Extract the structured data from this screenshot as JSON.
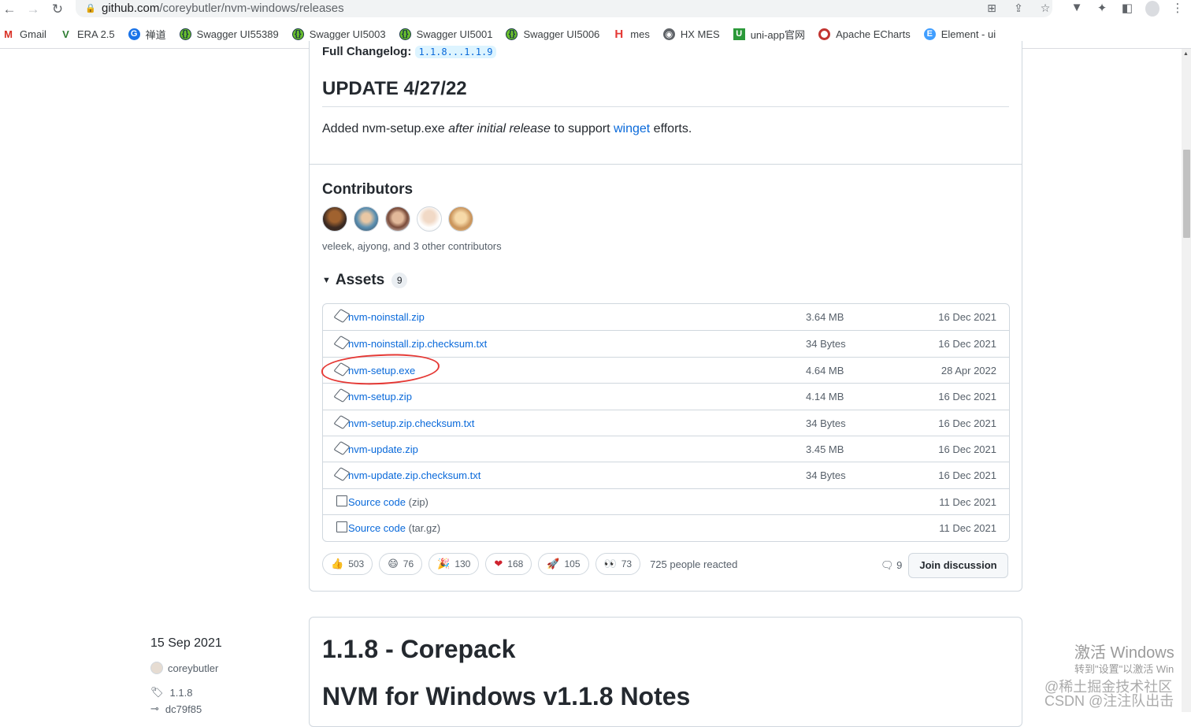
{
  "browser": {
    "url_host": "github.com",
    "url_path": "/coreybutler/nvm-windows/releases",
    "bookmarks": [
      {
        "label": "Gmail",
        "icon": "gmail-icon",
        "glyph": "M"
      },
      {
        "label": "ERA 2.5",
        "icon": "era-icon",
        "glyph": "V"
      },
      {
        "label": "禅道",
        "icon": "chandao-icon",
        "glyph": "G"
      },
      {
        "label": "Swagger UI55389",
        "icon": "swagger-icon",
        "glyph": "{}"
      },
      {
        "label": "Swagger UI5003",
        "icon": "swagger-icon",
        "glyph": "{}"
      },
      {
        "label": "Swagger UI5001",
        "icon": "swagger-icon",
        "glyph": "{}"
      },
      {
        "label": "Swagger UI5006",
        "icon": "swagger-icon",
        "glyph": "{}"
      },
      {
        "label": "mes",
        "icon": "mes-icon",
        "glyph": "H"
      },
      {
        "label": "HX MES",
        "icon": "globe-icon",
        "glyph": "◉"
      },
      {
        "label": "uni-app官网",
        "icon": "uniapp-icon",
        "glyph": "U"
      },
      {
        "label": "Apache ECharts",
        "icon": "echarts-icon",
        "glyph": ""
      },
      {
        "label": "Element - ui",
        "icon": "element-icon",
        "glyph": "E"
      }
    ]
  },
  "release": {
    "changelog_label": "Full Changelog:",
    "changelog_link": "1.1.8...1.1.9",
    "update_title": "UPDATE 4/27/22",
    "update_text_1": "Added nvm-setup.exe ",
    "update_text_em": "after initial release",
    "update_text_2": " to support ",
    "update_link": "winget",
    "update_text_3": " efforts.",
    "contributors_heading": "Contributors",
    "contributors_text": "veleek, ajyong, and 3 other contributors",
    "assets_heading": "Assets",
    "assets_count": "9",
    "assets": [
      {
        "name": "nvm-noinstall.zip",
        "ext": "",
        "size": "3.64 MB",
        "date": "16 Dec 2021"
      },
      {
        "name": "nvm-noinstall.zip.checksum.txt",
        "ext": "",
        "size": "34 Bytes",
        "date": "16 Dec 2021"
      },
      {
        "name": "nvm-setup.exe",
        "ext": "",
        "size": "4.64 MB",
        "date": "28 Apr 2022"
      },
      {
        "name": "nvm-setup.zip",
        "ext": "",
        "size": "4.14 MB",
        "date": "16 Dec 2021"
      },
      {
        "name": "nvm-setup.zip.checksum.txt",
        "ext": "",
        "size": "34 Bytes",
        "date": "16 Dec 2021"
      },
      {
        "name": "nvm-update.zip",
        "ext": "",
        "size": "3.45 MB",
        "date": "16 Dec 2021"
      },
      {
        "name": "nvm-update.zip.checksum.txt",
        "ext": "",
        "size": "34 Bytes",
        "date": "16 Dec 2021"
      },
      {
        "name": "Source code",
        "ext": " (zip)",
        "size": "",
        "date": "11 Dec 2021"
      },
      {
        "name": "Source code",
        "ext": " (tar.gz)",
        "size": "",
        "date": "11 Dec 2021"
      }
    ],
    "reactions": [
      {
        "emoji": "👍",
        "count": "503"
      },
      {
        "emoji": "😄",
        "count": "76"
      },
      {
        "emoji": "🎉",
        "count": "130"
      },
      {
        "emoji": "❤",
        "count": "168"
      },
      {
        "emoji": "🚀",
        "count": "105"
      },
      {
        "emoji": "👀",
        "count": "73"
      }
    ],
    "reacted_text": "725 people reacted",
    "comments_count": "9",
    "join_label": "Join discussion"
  },
  "next_release": {
    "date": "15 Sep 2021",
    "author": "coreybutler",
    "tag": "1.1.8",
    "commit": "dc79f85",
    "title": "1.1.8 - Corepack",
    "subtitle": "NVM for Windows v1.1.8 Notes"
  },
  "watermark": {
    "line1": "激活 Windows",
    "line2": "转到\"设置\"以激活 Win",
    "line3": "@稀土掘金技术社区",
    "line4": "CSDN @注注队出击"
  },
  "colors": {
    "link": "#0969da",
    "annotation": "#e53935"
  }
}
